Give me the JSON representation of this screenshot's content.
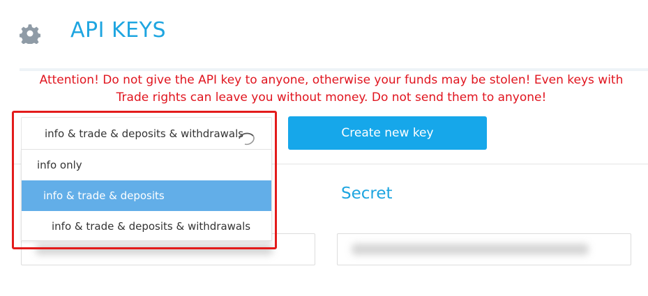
{
  "header": {
    "title": "API KEYS",
    "icon": "gear-icon"
  },
  "warning": {
    "text": "Attention! Do not give the API key to anyone, otherwise your funds may be stolen! Even keys with Trade rights can leave you without money. Do not send them to anyone!"
  },
  "permissions_select": {
    "selected_value": "info & trade & deposits & withdrawals",
    "options": [
      "info only",
      "info & trade & deposits",
      "info & trade & deposits & withdrawals"
    ],
    "highlighted_option": "info & trade & deposits"
  },
  "create_button": {
    "label": "Create new key"
  },
  "secret": {
    "label": "Secret"
  },
  "colors": {
    "accent": "#1ea5e0",
    "button": "#16a7ea",
    "warning": "#e0141e",
    "option_highlight": "#62aee8",
    "annotation_box": "#e31b1b"
  }
}
